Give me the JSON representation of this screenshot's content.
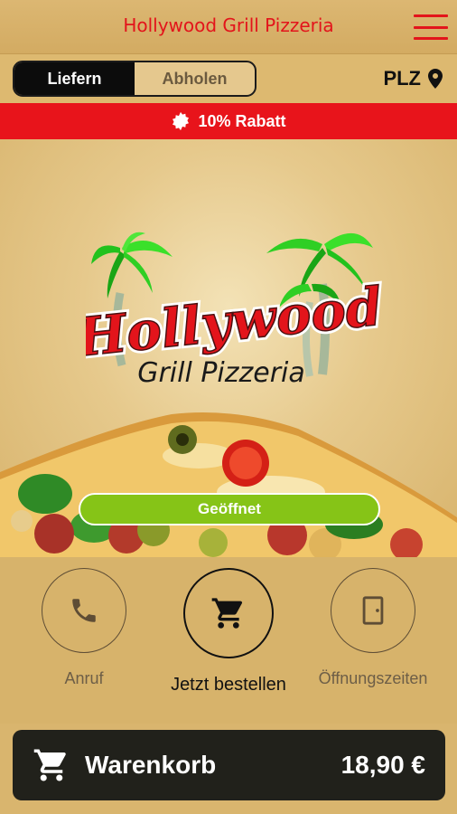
{
  "header": {
    "title": "Hollywood Grill Pizzeria",
    "menu_icon": "hamburger-menu-icon"
  },
  "mode": {
    "options": [
      "Liefern",
      "Abholen"
    ],
    "selected": "Liefern",
    "plz_label": "PLZ",
    "plz_icon": "location-pin-icon"
  },
  "discount": {
    "text": "10% Rabatt",
    "icon": "discount-burst-icon"
  },
  "hero": {
    "logo_text": "Hollywood",
    "logo_subtext": "Grill Pizzeria",
    "status": "Geöffnet"
  },
  "actions": [
    {
      "label": "Anruf",
      "icon": "phone-icon"
    },
    {
      "label": "Jetzt bestellen",
      "icon": "shopping-cart-icon"
    },
    {
      "label": "Öffnungszeiten",
      "icon": "door-icon"
    }
  ],
  "cart": {
    "label": "Warenkorb",
    "total": "18,90 €",
    "icon": "shopping-cart-icon"
  },
  "colors": {
    "brand_red": "#e3141b",
    "background": "#d9b56e",
    "open_green": "#86c417",
    "dark": "#21211b"
  }
}
